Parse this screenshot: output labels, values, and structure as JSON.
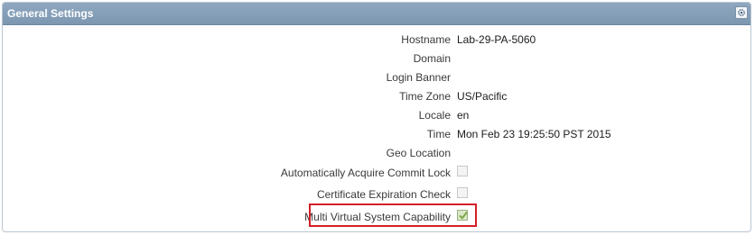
{
  "panel": {
    "title": "General Settings",
    "settings_icon": "gear-icon"
  },
  "rows": [
    {
      "label": "Hostname",
      "value": "Lab-29-PA-5060"
    },
    {
      "label": "Domain",
      "value": ""
    },
    {
      "label": "Login Banner",
      "value": ""
    },
    {
      "label": "Time Zone",
      "value": "US/Pacific"
    },
    {
      "label": "Locale",
      "value": "en"
    },
    {
      "label": "Time",
      "value": "Mon Feb 23 19:25:50 PST 2015"
    },
    {
      "label": "Geo Location",
      "value": ""
    },
    {
      "label": "Automatically Acquire Commit Lock",
      "checked": false
    },
    {
      "label": "Certificate Expiration Check",
      "checked": false
    },
    {
      "label": "Multi Virtual System Capability",
      "checked": true
    }
  ],
  "colors": {
    "header": "#7d97b1",
    "highlight": "#d32026",
    "check": "#7aa64a"
  }
}
